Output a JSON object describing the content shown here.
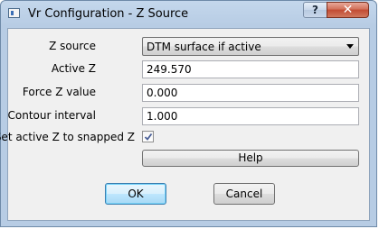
{
  "window": {
    "title": "Vr Configuration - Z Source",
    "help_button_label": "?",
    "close_button_label": "✕"
  },
  "form": {
    "z_source": {
      "label": "Z source",
      "value": "DTM surface if active"
    },
    "active_z": {
      "label": "Active Z",
      "value": "249.570"
    },
    "force_z": {
      "label": "Force Z value",
      "value": "0.000"
    },
    "contour_interval": {
      "label": "Contour interval",
      "value": "1.000"
    },
    "snap_active_z": {
      "label": "Set active Z to snapped Z",
      "checked": true
    }
  },
  "buttons": {
    "help": "Help",
    "ok": "OK",
    "cancel": "Cancel"
  }
}
